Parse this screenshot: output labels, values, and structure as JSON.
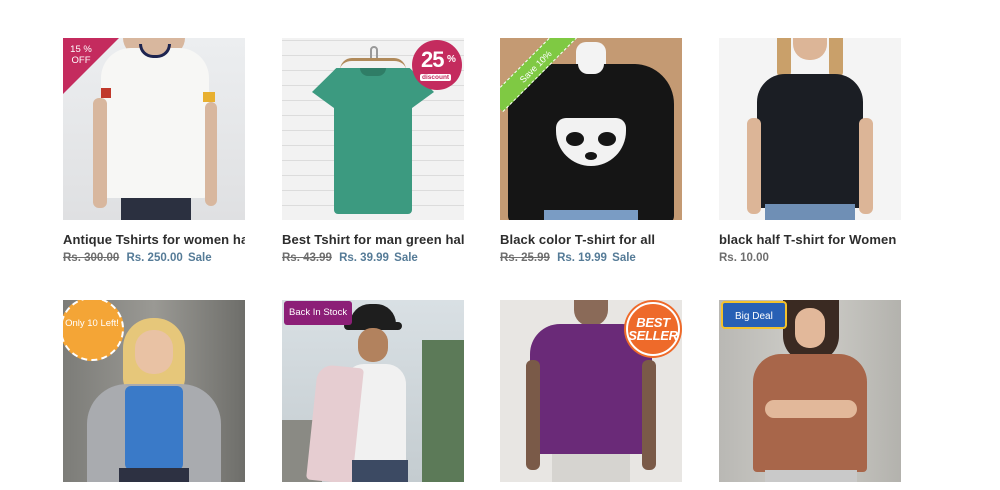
{
  "products": [
    {
      "title": "Antique Tshirts for women half",
      "old_price": "Rs. 300.00",
      "new_price": "Rs. 250.00",
      "sale_label": "Sale",
      "badge": "15 % OFF",
      "badge_color": "#c42b5e",
      "image": "woman-white-tshirt"
    },
    {
      "title": "Best Tshirt for man green half",
      "old_price": "Rs. 43.99",
      "new_price": "Rs. 39.99",
      "sale_label": "Sale",
      "badge_big": "25",
      "badge_percent": "%",
      "badge_small": "discount",
      "badge_color": "#c42b5e",
      "image": "green-tshirt-hanger"
    },
    {
      "title": "Black color T-shirt for all",
      "old_price": "Rs. 25.99",
      "new_price": "Rs. 19.99",
      "sale_label": "Sale",
      "badge": "Save 10%",
      "badge_color": "#7fc943",
      "image": "black-raccoon-tshirt"
    },
    {
      "title": "black half T-shirt for Women",
      "price": "Rs. 10.00",
      "image": "woman-black-tshirt"
    },
    {
      "badge": "Only 10 Left!",
      "badge_color": "#f4a536",
      "image": "woman-grey-cardigan"
    },
    {
      "badge": "Back In Stock",
      "badge_color": "#8c1f77",
      "image": "person-bucket-hat"
    },
    {
      "badge": "BEST SELLER",
      "badge_color": "#ee6a2a",
      "image": "man-purple-tshirt"
    },
    {
      "badge": "Big Deal",
      "badge_color": "#2860b5",
      "image": "woman-brown-tshirt"
    }
  ]
}
